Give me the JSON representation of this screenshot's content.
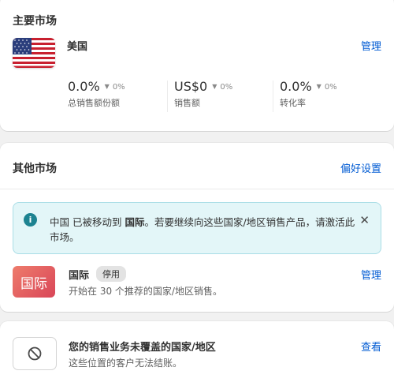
{
  "primary_market": {
    "title": "主要市场",
    "market_name": "美国",
    "manage_label": "管理",
    "flag_icon": "us-flag-icon",
    "stats": [
      {
        "value": "0.0%",
        "delta": "0%",
        "label": "总销售额份额"
      },
      {
        "value": "US$0",
        "delta": "0%",
        "label": "销售额"
      },
      {
        "value": "0.0%",
        "delta": "0%",
        "label": "转化率"
      }
    ]
  },
  "other_markets": {
    "title": "其他市场",
    "preferences_label": "偏好设置",
    "banner": {
      "text_before": "中国 已被移动到 ",
      "text_bold": "国际",
      "text_after": "。若要继续向这些国家/地区销售产品，请激活此市场。",
      "info_icon": "i"
    },
    "international": {
      "tile_text": "国际",
      "name": "国际",
      "status_badge": "停用",
      "description": "开始在 30 个推荐的国家/地区销售。",
      "manage_label": "管理"
    }
  },
  "uncovered": {
    "title": "您的销售业务未覆盖的国家/地区",
    "description": "这些位置的客户无法结账。",
    "view_label": "查看",
    "icon": "blocked-icon"
  },
  "colors": {
    "link": "#005bd3",
    "banner_bg": "#e3f6f8",
    "info_icon": "#1d8391"
  }
}
